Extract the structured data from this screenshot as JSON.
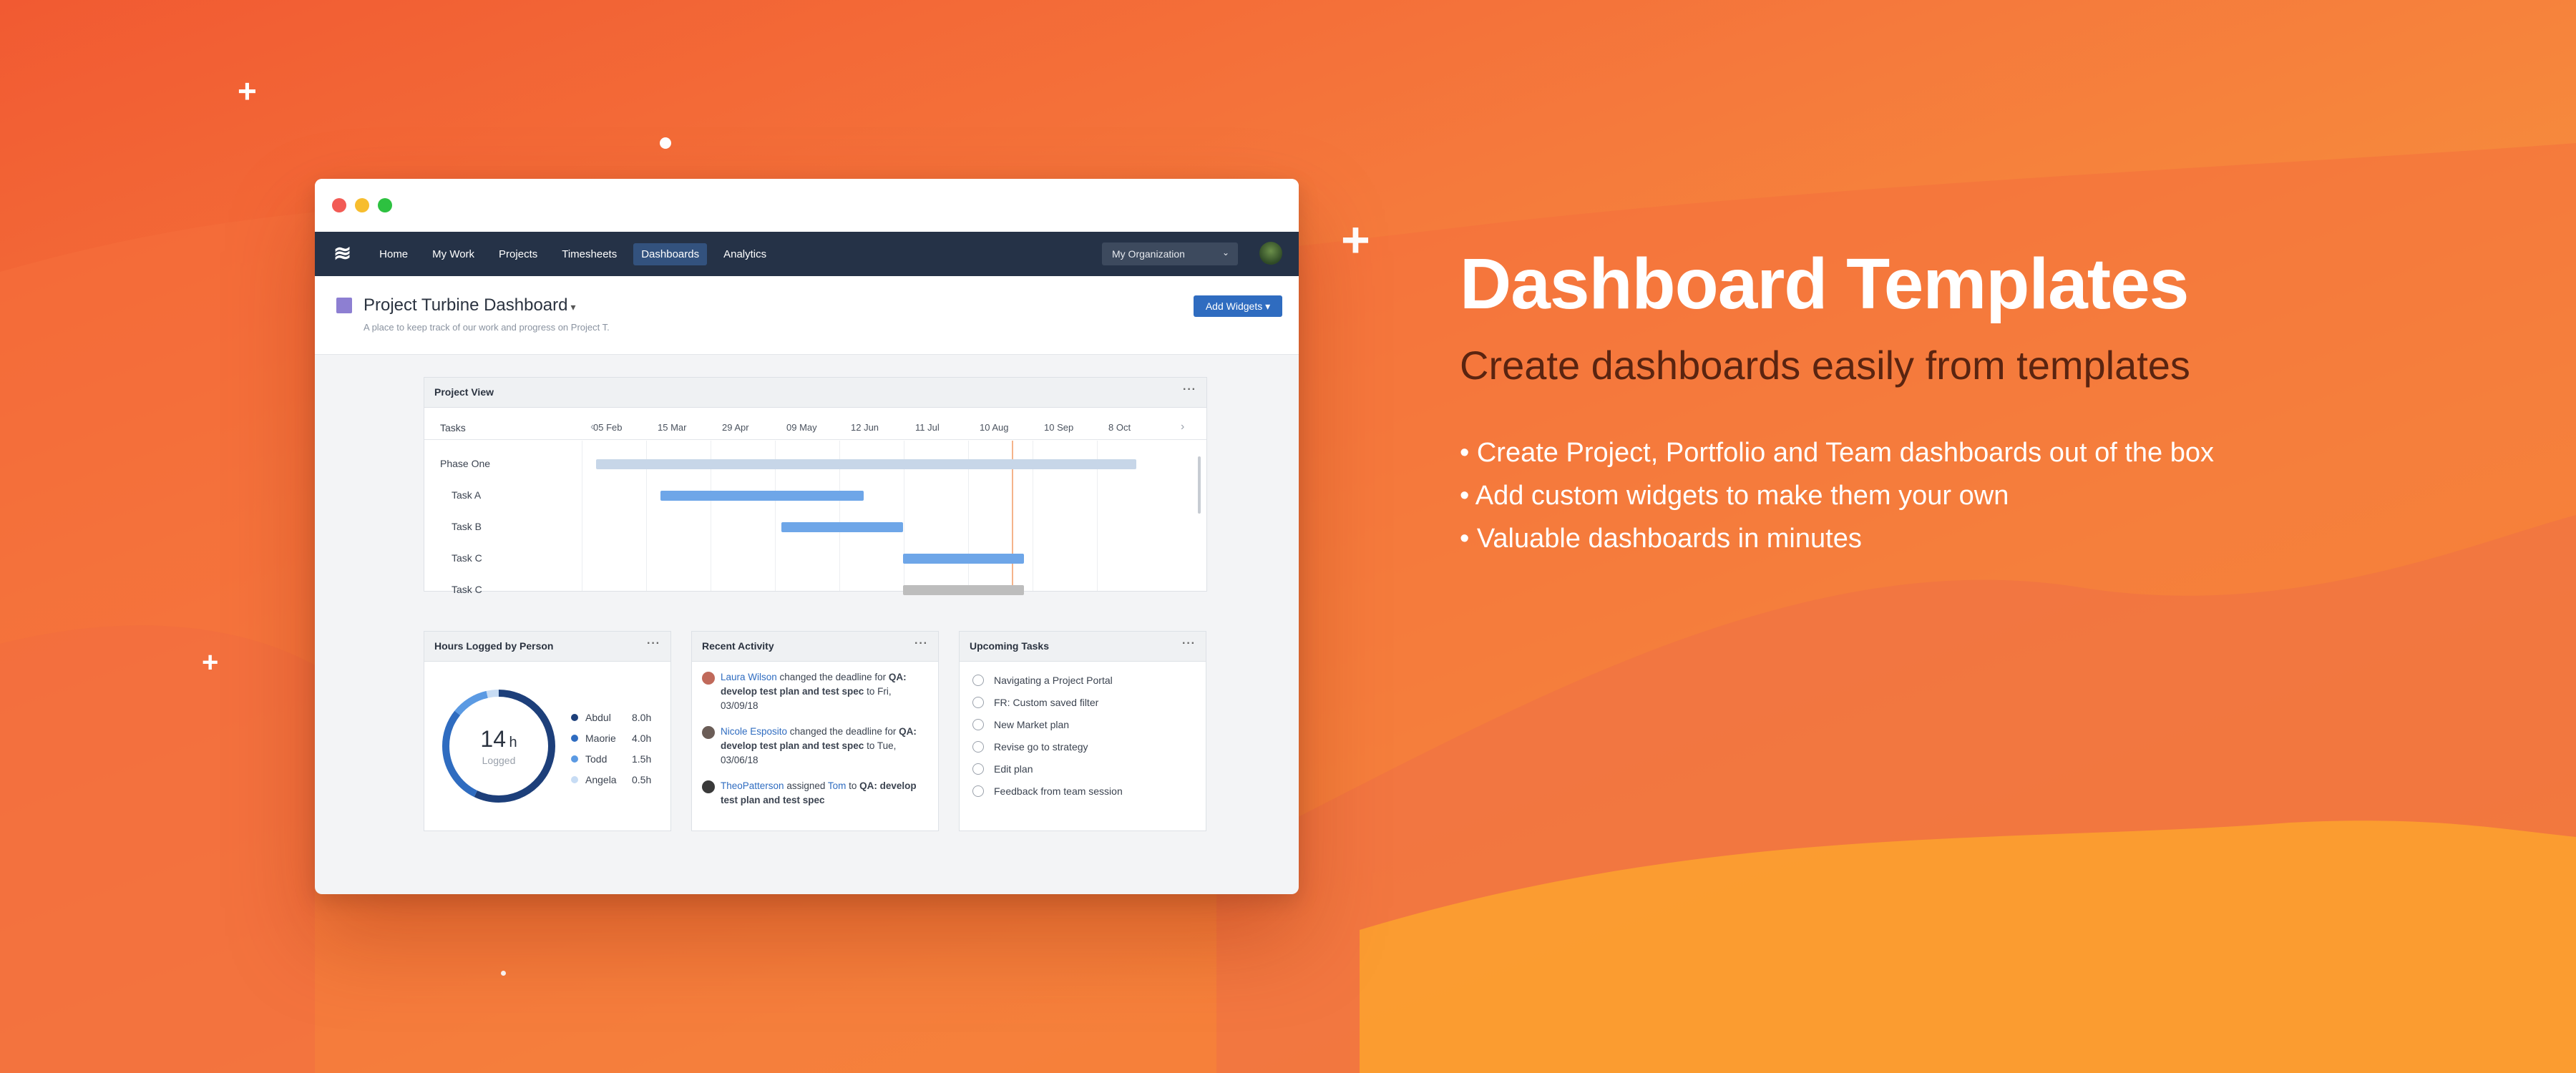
{
  "hero": {
    "title": "Dashboard Templates",
    "subtitle": "Create dashboards easily from templates",
    "bullets": [
      "• Create Project, Portfolio and Team dashboards out of the box",
      "• Add custom widgets to make them your own",
      "• Valuable dashboards in minutes"
    ]
  },
  "nav": {
    "logo": "≋",
    "items": [
      "Home",
      "My Work",
      "Projects",
      "Timesheets",
      "Dashboards",
      "Analytics"
    ],
    "active": "Dashboards",
    "org_select": "My Organization"
  },
  "dashboard": {
    "title": "Project Turbine Dashboard",
    "caret": "▾",
    "description": "A place to keep track of our work and progress on Project T.",
    "add_widgets": "Add Widgets ▾"
  },
  "project_view": {
    "title": "Project View",
    "more": "···",
    "tasks_header": "Tasks",
    "dates": [
      "05 Feb",
      "15 Mar",
      "29 Apr",
      "09 May",
      "12 Jun",
      "11 Jul",
      "10 Aug",
      "10 Sep",
      "8 Oct"
    ],
    "rows": [
      {
        "label": "Phase One",
        "start": 0.01,
        "end": 0.9,
        "color": "#c7d6e8"
      },
      {
        "label": "Task A",
        "start": 0.115,
        "end": 0.45,
        "color": "#6ea6e8"
      },
      {
        "label": "Task B",
        "start": 0.315,
        "end": 0.515,
        "color": "#6ea6e8"
      },
      {
        "label": "Task C",
        "start": 0.515,
        "end": 0.715,
        "color": "#6ea6e8"
      },
      {
        "label": "Task C",
        "start": 0.515,
        "end": 0.715,
        "color": "#bdbdbd"
      }
    ],
    "today_marker": 0.695
  },
  "hours": {
    "title": "Hours Logged by Person",
    "more": "···",
    "total_value": "14",
    "total_unit": "h",
    "total_label": "Logged",
    "people": [
      {
        "name": "Abdul",
        "hours": "8.0h",
        "value": 8.0,
        "color": "#1d3f7a"
      },
      {
        "name": "Maorie",
        "hours": "4.0h",
        "value": 4.0,
        "color": "#2f6cc0"
      },
      {
        "name": "Todd",
        "hours": "1.5h",
        "value": 1.5,
        "color": "#5b9ae3"
      },
      {
        "name": "Angela",
        "hours": "0.5h",
        "value": 0.5,
        "color": "#c7dcf4"
      }
    ]
  },
  "activity": {
    "title": "Recent Activity",
    "more": "···",
    "items": [
      {
        "user": "Laura Wilson",
        "action": " changed the deadline for ",
        "item": "QA: develop test plan and test spec",
        "tail": " to Fri, 03/09/18"
      },
      {
        "user": "Nicole Esposito",
        "action": " changed the deadline for ",
        "item": "QA: develop test plan and test spec",
        "tail": " to Tue, 03/06/18"
      },
      {
        "user": "TheoPatterson",
        "action": " assigned ",
        "assignee": "Tom",
        "action2": " to ",
        "item": "QA: develop test plan and test spec",
        "tail": ""
      }
    ]
  },
  "upcoming": {
    "title": "Upcoming Tasks",
    "more": "···",
    "tasks": [
      "Navigating a Project Portal",
      "FR: Custom saved filter",
      "New Market plan",
      "Revise go to strategy",
      "Edit plan",
      "Feedback from team session"
    ]
  },
  "colors": {
    "navbar": "#253247",
    "accent": "#2f6cc0",
    "background_gradient": [
      "#f15a32",
      "#fba02b"
    ]
  }
}
